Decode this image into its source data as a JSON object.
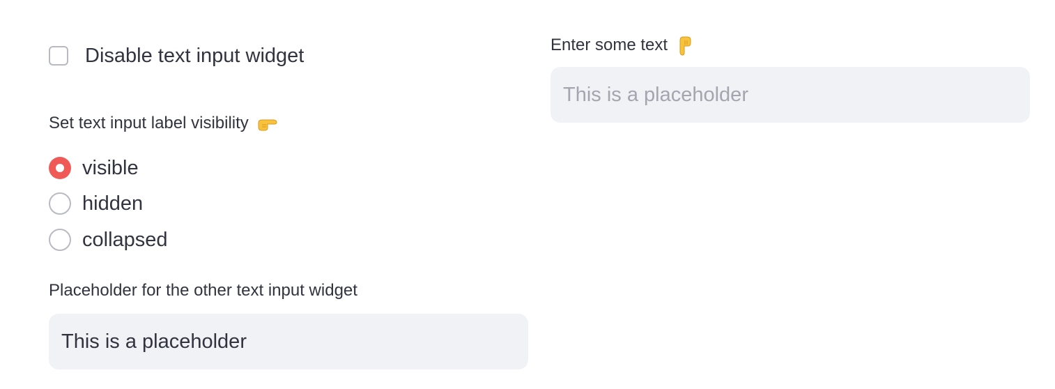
{
  "left_panel": {
    "disable_checkbox": {
      "label": "Disable text input widget",
      "checked": false
    },
    "visibility_radio": {
      "label": "Set text input label visibility",
      "label_icon": "pointing-right-hand-icon",
      "options": [
        "visible",
        "hidden",
        "collapsed"
      ],
      "selected": "visible"
    },
    "placeholder_field": {
      "label": "Placeholder for the other text input widget",
      "value": "This is a placeholder"
    }
  },
  "right_panel": {
    "text_input": {
      "label": "Enter some text",
      "label_icon": "pointing-down-hand-icon",
      "value": "",
      "placeholder": "This is a placeholder"
    }
  },
  "colors": {
    "accent": "#ef5a56",
    "input_bg": "#f0f2f6",
    "text": "#31333f",
    "placeholder": "#a3a6ae",
    "border": "#b8bac2"
  }
}
